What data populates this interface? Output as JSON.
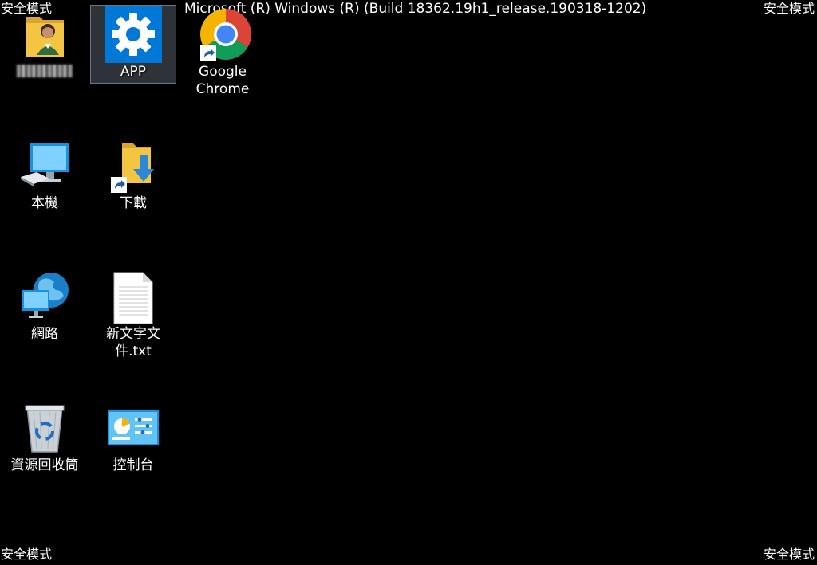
{
  "overlay": {
    "safe_mode_top_left": "安全模式",
    "safe_mode_top_right": "安全模式",
    "safe_mode_bottom_left": "安全模式",
    "safe_mode_bottom_right": "安全模式",
    "build_info": "Microsoft (R) Windows (R) (Build 18362.19h1_release.190318-1202)"
  },
  "desktop_icons": [
    {
      "id": "user-folder",
      "label": "",
      "icon": "user-folder-icon",
      "selected": false
    },
    {
      "id": "app",
      "label": "APP",
      "icon": "gear-icon",
      "selected": true
    },
    {
      "id": "google-chrome",
      "label": "Google Chrome",
      "icon": "chrome-icon",
      "shortcut": true,
      "selected": false
    },
    {
      "id": "this-pc",
      "label": "本機",
      "icon": "computer-icon",
      "selected": false
    },
    {
      "id": "downloads",
      "label": "下載",
      "icon": "download-folder-icon",
      "shortcut": true,
      "selected": false
    },
    {
      "id": "network",
      "label": "網路",
      "icon": "network-globe-icon",
      "selected": false
    },
    {
      "id": "text-file",
      "label": "新文字文件.txt",
      "icon": "text-document-icon",
      "selected": false
    },
    {
      "id": "recycle-bin",
      "label": "資源回收筒",
      "icon": "recycle-bin-icon",
      "selected": false
    },
    {
      "id": "control-panel",
      "label": "控制台",
      "icon": "control-panel-icon",
      "selected": false
    }
  ],
  "colors": {
    "background": "#000000",
    "selection_fill": "#cce8ff",
    "app_tile_blue": "#0078d7",
    "folder_yellow": "#f4c542",
    "download_arrow": "#2b88d8"
  }
}
